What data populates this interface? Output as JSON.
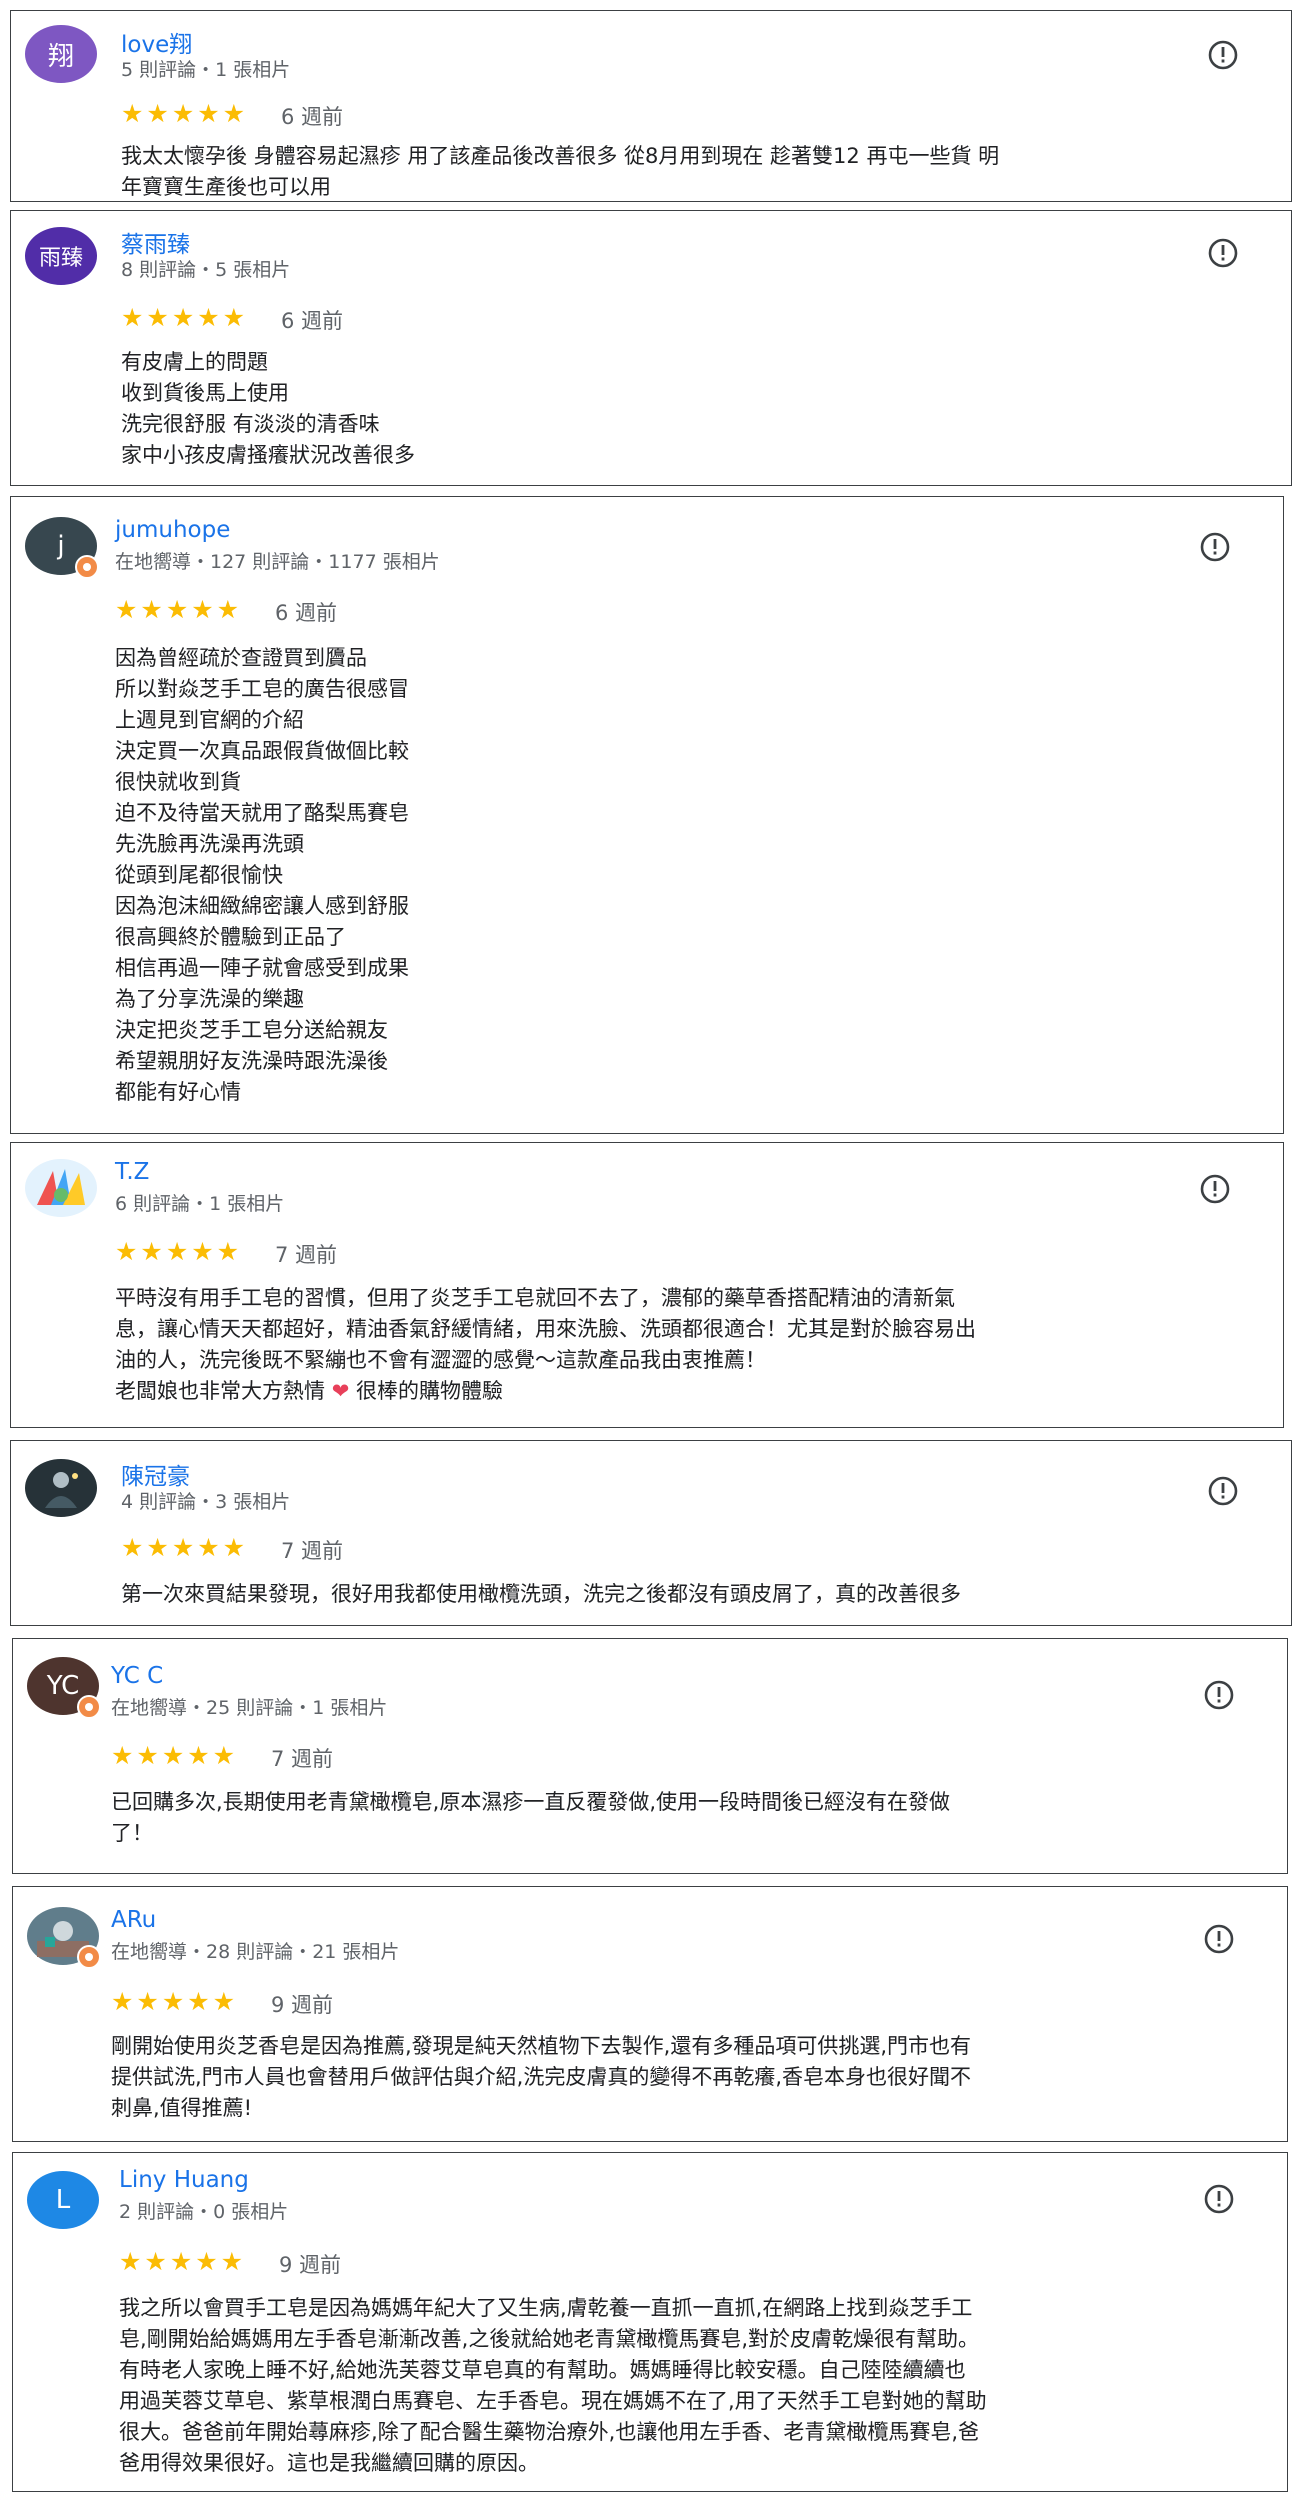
{
  "reviews": [
    {
      "name": "love翔",
      "avatar_text": "翔",
      "avatar_color": "#7e57c2",
      "meta": "5 則評論・1 張相片",
      "stars": "★★★★★",
      "rating": 5,
      "when": "6 週前",
      "lines": [
        "我太太懷孕後 身體容易起濕疹 用了該產品後改善很多 從8月用到現在 趁著雙12 再屯一些貨 明",
        "年寶寶生產後也可以用"
      ]
    },
    {
      "name": "蔡雨臻",
      "avatar_text": "雨臻",
      "avatar_color": "#512da8",
      "meta": "8 則評論・5 張相片",
      "stars": "★★★★★",
      "rating": 5,
      "when": "6 週前",
      "lines": [
        "有皮膚上的問題",
        "收到貨後馬上使用",
        "洗完很舒服 有淡淡的清香味",
        "家中小孩皮膚搔癢狀況改善很多"
      ]
    },
    {
      "name": "jumuhope",
      "avatar_text": "j",
      "avatar_color": "#37474f",
      "meta": "在地嚮導・127 則評論・1177 張相片",
      "stars": "★★★★★",
      "rating": 5,
      "when": "6 週前",
      "lines": [
        "因為曾經疏於查證買到贗品",
        "所以對焱芝手工皂的廣告很感冒",
        "上週見到官網的介紹",
        "決定買一次真品跟假貨做個比較",
        "很快就收到貨",
        "迫不及待當天就用了酪梨馬賽皂",
        "先洗臉再洗澡再洗頭",
        "從頭到尾都很愉快",
        "因為泡沫細緻綿密讓人感到舒服",
        "很高興終於體驗到正品了",
        "相信再過一陣子就會感受到成果",
        "為了分享洗澡的樂趣",
        "決定把炎芝手工皂分送給親友",
        "希望親朋好友洗澡時跟洗澡後",
        "都能有好心情"
      ]
    },
    {
      "name": "T.Z",
      "avatar_text": "",
      "avatar_color": "#e3f2fd",
      "meta": "6 則評論・1 張相片",
      "stars": "★★★★★",
      "rating": 5,
      "when": "7 週前",
      "lines": [
        "平時沒有用手工皂的習慣，但用了炎芝手工皂就回不去了，濃郁的藥草香搭配精油的清新氣",
        "息，讓心情天天都超好，精油香氣舒緩情緒，用來洗臉、洗頭都很適合！尤其是對於臉容易出",
        "油的人，洗完後既不緊繃也不會有澀澀的感覺～這款產品我由衷推薦！"
      ],
      "extra_before": "老闆娘也非常大方熱情",
      "extra_heart": "❤",
      "extra_after": "很棒的購物體驗"
    },
    {
      "name": "陳冠豪",
      "avatar_text": "",
      "avatar_color": "#263238",
      "meta": "4 則評論・3 張相片",
      "stars": "★★★★★",
      "rating": 5,
      "when": "7 週前",
      "lines": [
        "第一次來買結果發現，很好用我都使用橄欖洗頭，洗完之後都沒有頭皮屑了，真的改善很多"
      ]
    },
    {
      "name": "YC C",
      "avatar_text": "YC",
      "avatar_color": "#4e342e",
      "meta": "在地嚮導・25 則評論・1 張相片",
      "stars": "★★★★★",
      "rating": 5,
      "when": "7 週前",
      "lines": [
        "已回購多次,長期使用老青黛橄欖皂,原本濕疹一直反覆發做,使用一段時間後已經沒有在發做",
        "了！"
      ]
    },
    {
      "name": "ARu",
      "avatar_text": "",
      "avatar_color": "#607d8b",
      "meta": "在地嚮導・28 則評論・21 張相片",
      "stars": "★★★★★",
      "rating": 5,
      "when": "9 週前",
      "lines": [
        "剛開始使用炎芝香皂是因為推薦,發現是純天然植物下去製作,還有多種品項可供挑選,門市也有",
        "提供試洗,門市人員也會替用戶做評估與介紹,洗完皮膚真的變得不再乾癢,香皂本身也很好聞不",
        "刺鼻,值得推薦!"
      ]
    },
    {
      "name": "Liny Huang",
      "avatar_text": "L",
      "avatar_color": "#1e88e5",
      "meta": "2 則評論・0 張相片",
      "stars": "★★★★★",
      "rating": 5,
      "when": "9 週前",
      "lines": [
        "我之所以會買手工皂是因為媽媽年紀大了又生病,膚乾養一直抓一直抓,在網路上找到焱芝手工",
        "皂,剛開始給媽媽用左手香皂漸漸改善,之後就給她老青黛橄欖馬賽皂,對於皮膚乾燥很有幫助。",
        "有時老人家晚上睡不好,給她洗芙蓉艾草皂真的有幫助。媽媽睡得比較安穩。自己陸陸續續也",
        "用過芙蓉艾草皂、紫草根潤白馬賽皂、左手香皂。現在媽媽不在了,用了天然手工皂對她的幫助",
        "很大。爸爸前年開始蕁麻疹,除了配合醫生藥物治療外,也讓他用左手香、老青黛橄欖馬賽皂,爸",
        "爸用得效果很好。這也是我繼續回購的原因。"
      ]
    }
  ]
}
